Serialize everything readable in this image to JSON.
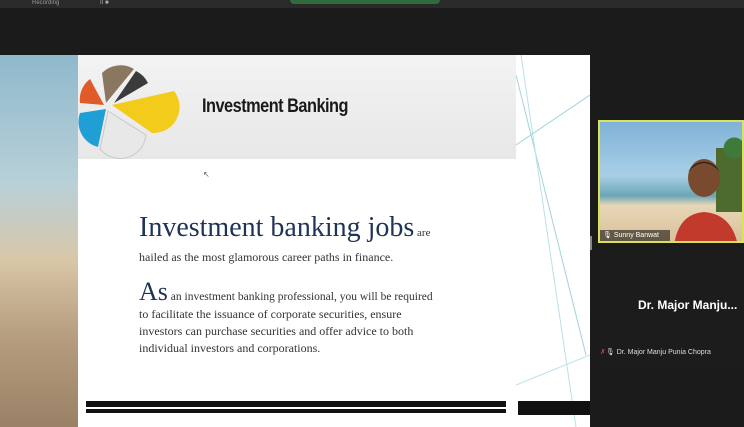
{
  "topbar": {
    "recording_label": "Recording",
    "controls": "II ■"
  },
  "slide": {
    "title": "Investment Banking",
    "para1_big": "Investment banking jobs",
    "para1_small": " are",
    "para1_line2": "hailed as the most glamorous career paths in finance.",
    "para2_big": "As",
    "para2_line1": " an investment banking professional, you will be required",
    "para2_line2": "to facilitate the issuance of corporate securities, ensure",
    "para2_line3": "investors can purchase securities and offer advice to both",
    "para2_line4": "individual investors and corporations."
  },
  "participants": [
    {
      "tile_label": "Sunny Banwat"
    },
    {
      "display_name": "Dr. Major Manju...",
      "tile_label": "Dr. Major Manju Punia Chopra"
    }
  ],
  "colors": {
    "active_speaker_border": "#d8e35b",
    "muted_icon": "#e04040",
    "slide_heading": "#1f3358"
  },
  "icons": [
    "pie-chart-icon",
    "mic-icon",
    "muted-mic-icon",
    "mouse-cursor-icon"
  ]
}
